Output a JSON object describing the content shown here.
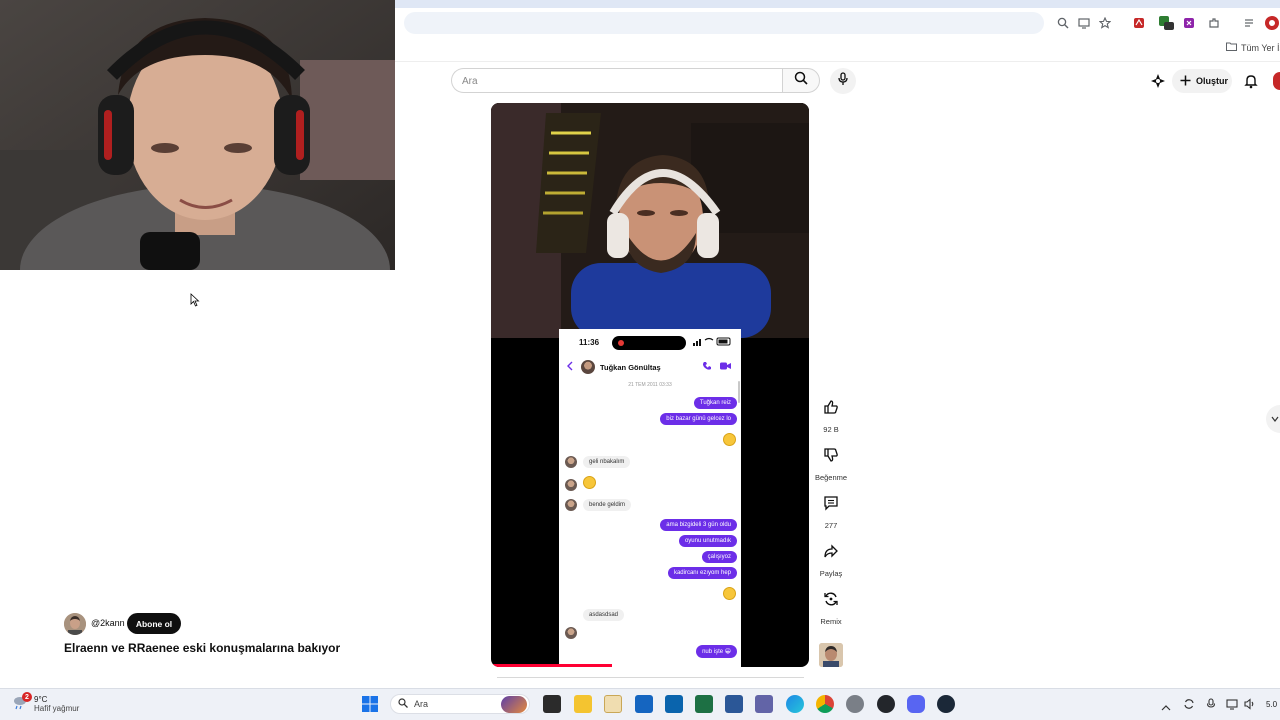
{
  "browser": {
    "bookmarks_label": "Tüm Yer İş"
  },
  "header": {
    "search_placeholder": "Ara",
    "create_label": "Oluştur"
  },
  "short": {
    "phone": {
      "time": "11:36",
      "contact_name": "Tuğkan Gönültaş",
      "date": "21 TEM 2011 03:33",
      "messages": [
        {
          "dir": "out",
          "text": "Tuğkan reiz"
        },
        {
          "dir": "out",
          "text": "biz bazar günü gelcez lo"
        },
        {
          "dir": "out",
          "emoji": true
        },
        {
          "dir": "in",
          "text": "geli nbakalım"
        },
        {
          "dir": "in",
          "emoji": true
        },
        {
          "dir": "in",
          "text": "bende geldim"
        },
        {
          "dir": "out",
          "text": "ama bizgideli 3 gün oldu"
        },
        {
          "dir": "out",
          "text": "oyunu unutmadık"
        },
        {
          "dir": "out",
          "text": "çalışıyoz"
        },
        {
          "dir": "out",
          "text": "kadircanı ezıyom hep"
        },
        {
          "dir": "out",
          "emoji": true
        },
        {
          "dir": "in",
          "text": "asdasdsad"
        },
        {
          "dir": "out",
          "text": "nub işte 😀"
        }
      ]
    },
    "progress_fraction": 0.38
  },
  "actions": {
    "like_count": "92 B",
    "dislike_label": "Beğenme",
    "comment_count": "277",
    "share_label": "Paylaş",
    "remix_label": "Remix"
  },
  "channel": {
    "handle": "@2kann",
    "subscribe_label": "Abone ol",
    "video_title": "Elraenn ve RRaenee eski konuşmalarına bakıyor"
  },
  "taskbar": {
    "weather_badge": "2",
    "weather_temp": "9°C",
    "weather_desc": "Hafif yağmur",
    "search_label": "Ara",
    "clock": "5.0"
  },
  "colors": {
    "brand_red": "#ff0033",
    "message_purple": "#6c2ee8",
    "subscribe_bg": "#0f0f0f"
  }
}
